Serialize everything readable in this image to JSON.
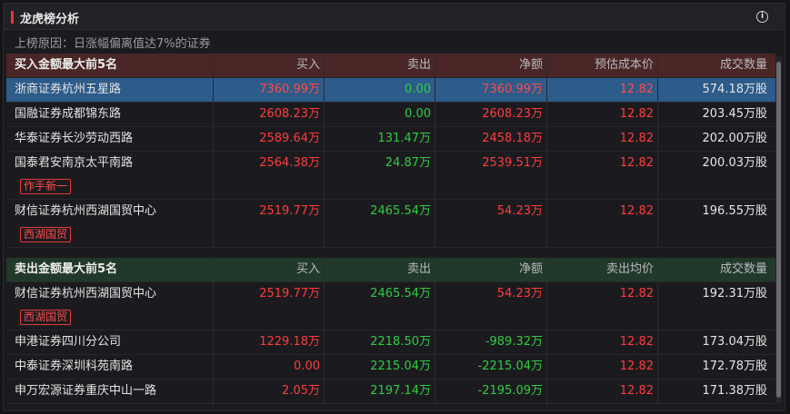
{
  "title": "龙虎榜分析",
  "reason": "上榜原因：日涨幅偏离值达7%的证券",
  "buy_section": {
    "headers": [
      "买入金额最大前5名",
      "买入",
      "卖出",
      "净额",
      "预估成本价",
      "成交数量"
    ],
    "rows": [
      {
        "name": "浙商证券杭州五星路",
        "buy": "7360.99万",
        "sell": "0.00",
        "net": "7360.99万",
        "price": "12.82",
        "volume": "574.18万股",
        "tag": ""
      },
      {
        "name": "国融证券成都锦东路",
        "buy": "2608.23万",
        "sell": "0.00",
        "net": "2608.23万",
        "price": "12.82",
        "volume": "203.45万股",
        "tag": ""
      },
      {
        "name": "华泰证券长沙劳动西路",
        "buy": "2589.64万",
        "sell": "131.47万",
        "net": "2458.18万",
        "price": "12.82",
        "volume": "202.00万股",
        "tag": ""
      },
      {
        "name": "国泰君安南京太平南路",
        "buy": "2564.38万",
        "sell": "24.87万",
        "net": "2539.51万",
        "price": "12.82",
        "volume": "200.03万股",
        "tag": "作手新一"
      },
      {
        "name": "财信证券杭州西湖国贸中心",
        "buy": "2519.77万",
        "sell": "2465.54万",
        "net": "54.23万",
        "price": "12.82",
        "volume": "196.55万股",
        "tag": "西湖国贸"
      }
    ]
  },
  "sell_section": {
    "headers": [
      "卖出金额最大前5名",
      "买入",
      "卖出",
      "净额",
      "卖出均价",
      "成交数量"
    ],
    "rows": [
      {
        "name": "财信证券杭州西湖国贸中心",
        "buy": "2519.77万",
        "sell": "2465.54万",
        "net": "54.23万",
        "price": "12.82",
        "volume": "192.31万股",
        "tag": "西湖国贸"
      },
      {
        "name": "申港证券四川分公司",
        "buy": "1229.18万",
        "sell": "2218.50万",
        "net": "-989.32万",
        "price": "12.82",
        "volume": "173.04万股",
        "tag": ""
      },
      {
        "name": "中泰证券深圳科苑南路",
        "buy": "0.00",
        "sell": "2215.04万",
        "net": "-2215.04万",
        "price": "12.82",
        "volume": "172.78万股",
        "tag": ""
      },
      {
        "name": "申万宏源证券重庆中山一路",
        "buy": "2.05万",
        "sell": "2197.14万",
        "net": "-2195.09万",
        "price": "12.82",
        "volume": "171.38万股",
        "tag": ""
      }
    ]
  },
  "colors": {
    "up": "#ff3b3b",
    "down": "#2ecc40",
    "highlight": "#2d5b8a",
    "buy_header": "#4a2626",
    "sell_header": "#21392a"
  }
}
